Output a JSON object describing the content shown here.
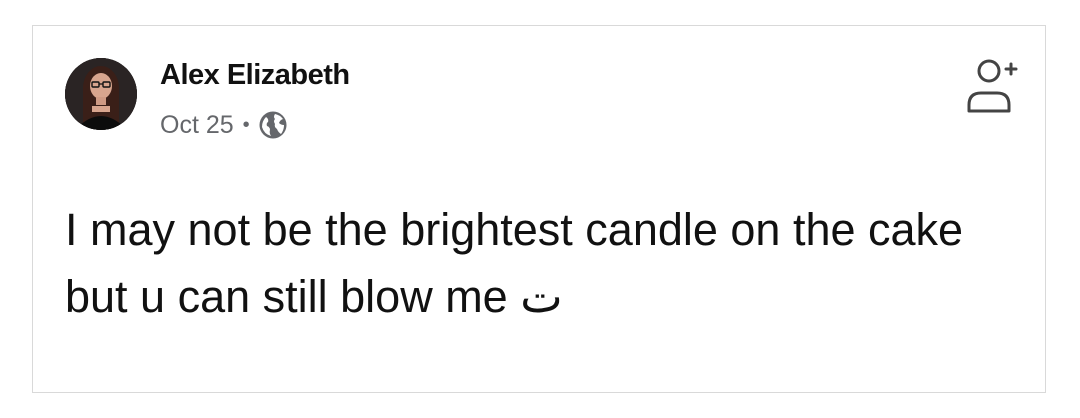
{
  "post": {
    "author_name": "Alex Elizabeth",
    "date": "Oct 25",
    "separator": "•",
    "visibility_icon": "globe-icon",
    "follow_icon": "add-friend-icon",
    "text": "I may not be the brightest candle on the cake but u can still blow me ت"
  },
  "colors": {
    "card_border": "#d9d9d9",
    "text_primary": "#111111",
    "text_secondary": "#65676b"
  }
}
